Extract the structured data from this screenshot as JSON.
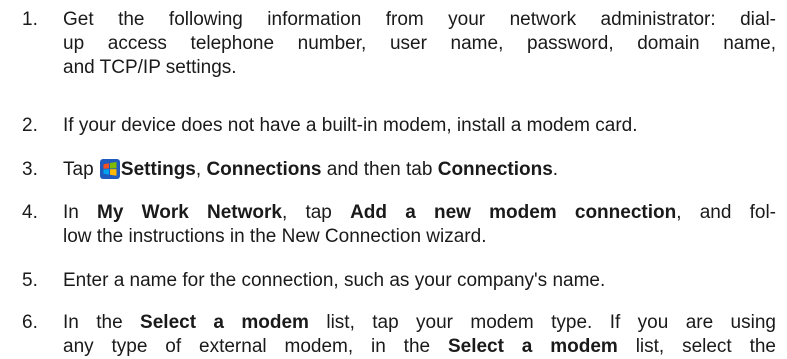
{
  "steps": [
    {
      "number": "1.",
      "lines": [
        [
          "Get the following information from your network administrator: dial-"
        ],
        [
          "up access telephone number, user name, password, domain name,"
        ],
        [
          "and TCP/IP settings."
        ]
      ]
    },
    {
      "number": "2.",
      "lines": [
        [
          "If your device does not have a built-in modem, install a modem card."
        ]
      ]
    },
    {
      "number": "3.",
      "seg": {
        "tap": "Tap ",
        "settings": "Settings",
        "comma": ", ",
        "connections": "Connections",
        "and_then": " and then tab ",
        "connections_tab": "Connections",
        "period": "."
      }
    },
    {
      "number": "4.",
      "seg": {
        "in": "In ",
        "network": "My Work Network",
        "tap": ", tap ",
        "add": "Add a new modem connection",
        "rest1": ", and fol-",
        "line2": "low the instructions in the New Connection wizard."
      }
    },
    {
      "number": "5.",
      "lines": [
        [
          "Enter a name for the connection, such as your company's name."
        ]
      ]
    },
    {
      "number": "6.",
      "seg": {
        "in": "In the ",
        "select1": "Select a modem",
        "rest1": " list, tap your modem type. If you are using",
        "line2a": "any type of external modem, in the ",
        "select2": "Select a modem",
        "line2b": " list, select the"
      }
    }
  ],
  "icon": {
    "name": "windows-start-icon",
    "colors": [
      "#f25022",
      "#7fba00",
      "#00a4ef",
      "#ffb900",
      "#1f5bbf"
    ]
  }
}
